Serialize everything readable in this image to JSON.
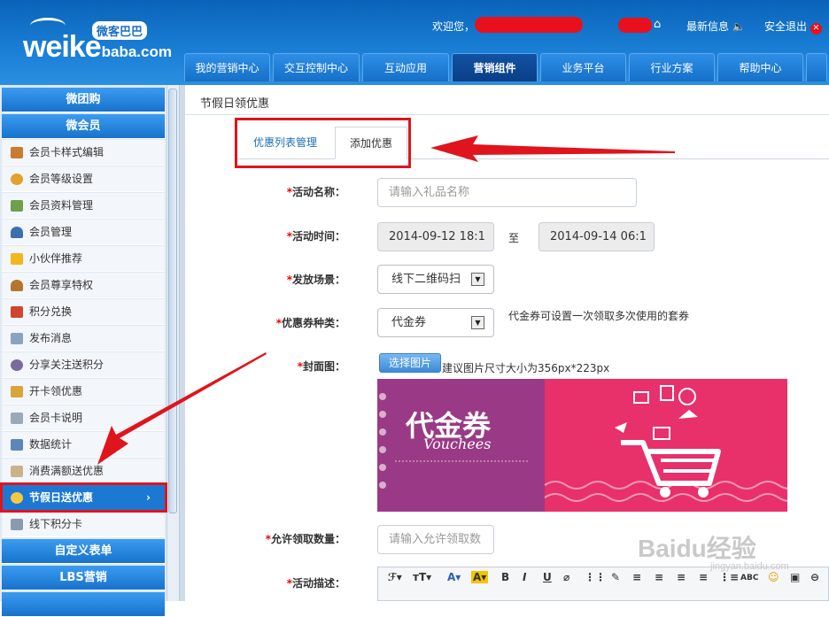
{
  "header": {
    "logo_text": "weike",
    "logo_suffix": "baba.com",
    "logo_cn": "微客巴巴",
    "welcome": "欢迎您，",
    "latest_info": "最新信息",
    "logout": "安全退出"
  },
  "nav": [
    "我的营销中心",
    "交互控制中心",
    "互动应用",
    "营销组件",
    "业务平台",
    "行业方案",
    "帮助中心"
  ],
  "nav_active": "营销组件",
  "sidebar": {
    "head_top": "微团购",
    "head_member": "微会员",
    "items": [
      "会员卡样式编辑",
      "会员等级设置",
      "会员资料管理",
      "会员管理",
      "小伙伴推荐",
      "会员尊享特权",
      "积分兑换",
      "发布消息",
      "分享关注送积分",
      "开卡领优惠",
      "会员卡说明",
      "数据统计",
      "消费满额送优惠",
      "节假日送优惠",
      "线下积分卡"
    ],
    "active_item": "节假日送优惠",
    "active_arrow": "›",
    "head_form": "自定义表单",
    "head_lbs": "LBS营销"
  },
  "page": {
    "title": "节假日领优惠",
    "tab_list": "优惠列表管理",
    "tab_add": "添加优惠"
  },
  "form": {
    "star": "*",
    "name_label": "活动名称：",
    "name_placeholder": "请输入礼品名称",
    "time_label": "活动时间：",
    "time_start": "2014-09-12 18:1",
    "time_to": "至",
    "time_end": "2014-09-14 06:1",
    "scene_label": "发放场景：",
    "scene_value": "线下二维码扫",
    "type_label": "优惠券种类：",
    "type_value": "代金券",
    "type_hint": "代金券可设置一次领取多次使用的套券",
    "cover_label": "封面图：",
    "upload_button": "选择图片",
    "cover_hint": "建议图片尺寸大小为356px*223px",
    "voucher_title": "代金券",
    "voucher_sub": "Vouchees",
    "limit_label": "允许领取数量：",
    "limit_placeholder": "请输入允许领取数",
    "desc_label": "活动描述："
  },
  "editor_tools": [
    "ℱ▾",
    "тT▾",
    "A▾",
    "A▾",
    "B",
    "I",
    "U",
    "⌀",
    "⋮⋮",
    "✎",
    "≡",
    "≡",
    "≡",
    "≡",
    "⋮≡",
    "ABC",
    "☺",
    "▣",
    "⊖"
  ],
  "watermark": {
    "text": "Baidu经验",
    "sub": "jingyan.baidu.com"
  },
  "colors": {
    "primary": "#1c78d2",
    "highlight": "#e0141c",
    "voucher_left": "#9a3a86",
    "voucher_right": "#e8306b"
  }
}
